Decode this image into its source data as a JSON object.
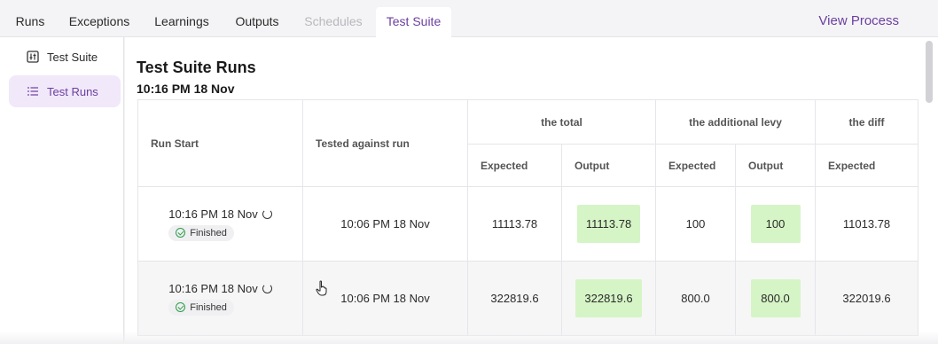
{
  "tabs": [
    {
      "label": "Runs",
      "state": "normal"
    },
    {
      "label": "Exceptions",
      "state": "normal"
    },
    {
      "label": "Learnings",
      "state": "normal"
    },
    {
      "label": "Outputs",
      "state": "normal"
    },
    {
      "label": "Schedules",
      "state": "disabled"
    },
    {
      "label": "Test Suite",
      "state": "active"
    }
  ],
  "view_process": "View Process",
  "sidebar": {
    "items": [
      {
        "label": "Test Suite",
        "icon": "test-suite-icon"
      },
      {
        "label": "Test Runs",
        "icon": "list-icon",
        "active": true
      }
    ]
  },
  "page": {
    "title": "Test Suite Runs",
    "subtitle": "10:16 PM 18 Nov"
  },
  "table": {
    "col_run_start": "Run Start",
    "col_tested_against": "Tested against run",
    "groups": [
      "the total",
      "the additional levy",
      "the diff"
    ],
    "sub_expected": "Expected",
    "sub_output": "Output",
    "rows": [
      {
        "run_start": "10:16 PM 18 Nov",
        "status": "Finished",
        "tested_against": "10:06 PM 18 Nov",
        "total_expected": "11113.78",
        "total_output": "11113.78",
        "levy_expected": "100",
        "levy_output": "100",
        "diff_expected": "11013.78"
      },
      {
        "run_start": "10:16 PM 18 Nov",
        "status": "Finished",
        "tested_against": "10:06 PM 18 Nov",
        "total_expected": "322819.6",
        "total_output": "322819.6",
        "levy_expected": "800.0",
        "levy_output": "800.0",
        "diff_expected": "322019.6"
      }
    ]
  },
  "colors": {
    "accent": "#6b3fa0",
    "match_green": "#d6f5c6",
    "finished_green": "#2e9e4a"
  }
}
